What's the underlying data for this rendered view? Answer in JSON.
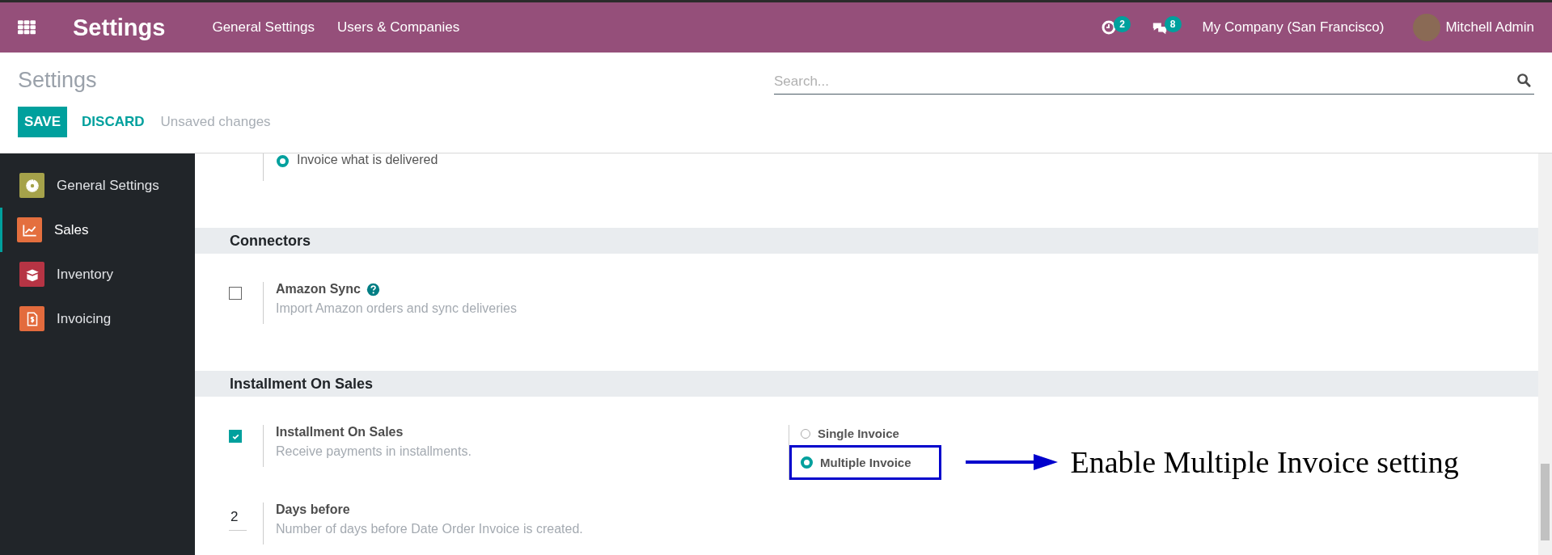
{
  "navbar": {
    "title": "Settings",
    "menu": [
      "General Settings",
      "Users & Companies"
    ],
    "activity_count": "2",
    "message_count": "8",
    "company": "My Company (San Francisco)",
    "user": "Mitchell Admin"
  },
  "control_panel": {
    "breadcrumb": "Settings",
    "search": {
      "placeholder": "Search..."
    },
    "buttons": [
      "SAVE",
      "DISCARD"
    ],
    "status": "Unsaved changes"
  },
  "sidebar": {
    "items": [
      {
        "label": "General Settings",
        "kind": "gear",
        "color": "#a5a24a",
        "selected": false
      },
      {
        "label": "Sales",
        "kind": "chart",
        "color": "#e46f3e",
        "selected": true
      },
      {
        "label": "Inventory",
        "kind": "box",
        "color": "#b63444",
        "selected": false
      },
      {
        "label": "Invoicing",
        "kind": "invoice",
        "color": "#e36b3d",
        "selected": false
      }
    ]
  },
  "partial_option": {
    "label": "Invoice what is delivered",
    "selected": true
  },
  "sections": [
    {
      "title": "Connectors",
      "settings": [
        {
          "kind": "checkbox",
          "checked": false,
          "label": "Amazon Sync",
          "help": true,
          "description": "Import Amazon orders and sync deliveries"
        }
      ]
    },
    {
      "title": "Installment On Sales",
      "settings": [
        {
          "kind": "checkbox",
          "checked": true,
          "label": "Installment On Sales",
          "help": false,
          "description": "Receive payments in installments.",
          "options": [
            {
              "label": "Single Invoice",
              "selected": false,
              "highlighted": false
            },
            {
              "label": "Multiple Invoice",
              "selected": true,
              "highlighted": true
            }
          ]
        },
        {
          "kind": "number",
          "value": "2",
          "label": "Days before",
          "help": false,
          "description": "Number of days before Date Order Invoice is created."
        }
      ]
    }
  ],
  "annotation": {
    "text": "Enable Multiple Invoice setting"
  }
}
